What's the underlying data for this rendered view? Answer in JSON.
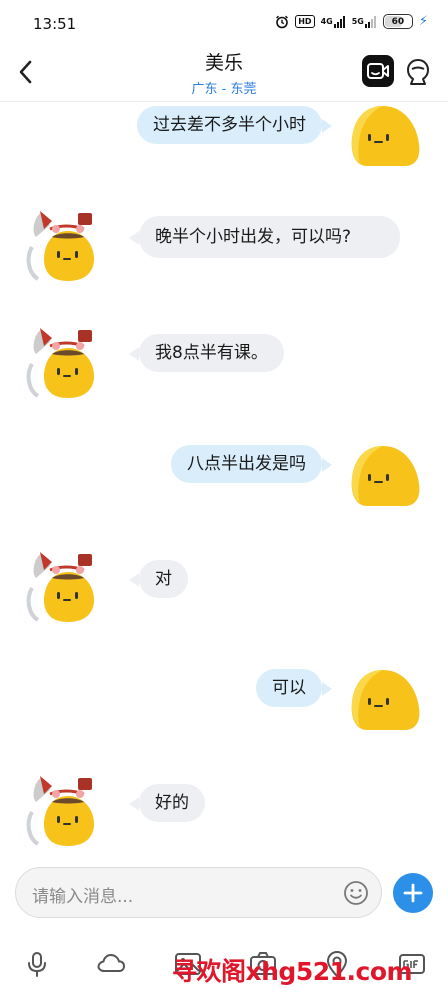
{
  "status_bar": {
    "time": "13:51",
    "hd_label": "HD",
    "sim1_label": "4G",
    "sim2_label": "5G",
    "battery": "60"
  },
  "header": {
    "back_icon": "chevron-left-icon",
    "title": "美乐",
    "subtitle": "广东 - 东莞",
    "video_icon": "video-call-icon",
    "profile_icon": "profile-icon"
  },
  "messages": [
    {
      "direction": "sent",
      "text": "过去差不多半个小时"
    },
    {
      "direction": "received",
      "text": "晚半个小时出发，可以吗?"
    },
    {
      "direction": "received",
      "text": "我8点半有课。"
    },
    {
      "direction": "sent",
      "text": "八点半出发是吗"
    },
    {
      "direction": "received",
      "text": "对"
    },
    {
      "direction": "sent",
      "text": "可以"
    },
    {
      "direction": "received",
      "text": "好的"
    }
  ],
  "input": {
    "placeholder": "请输入消息..."
  },
  "toolbar": {
    "icons": [
      "microphone-icon",
      "cloud-icon",
      "image-icon",
      "camera-icon",
      "location-icon",
      "gif-icon"
    ]
  },
  "watermark": "寻欢阁xhg521.com",
  "colors": {
    "accent": "#2c8fe8",
    "sent_bubble": "#d9edfb",
    "received_bubble": "#eeeff2",
    "watermark": "#e0162a"
  }
}
